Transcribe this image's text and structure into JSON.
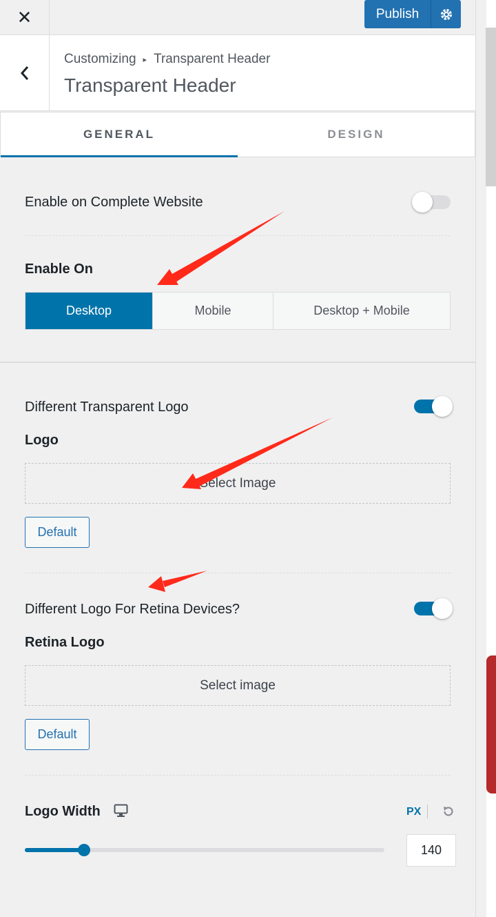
{
  "topbar": {
    "close_label": "✕",
    "publish_label": "Publish"
  },
  "header": {
    "breadcrumb_root": "Customizing",
    "breadcrumb_sep": "▸",
    "breadcrumb_current": "Transparent Header",
    "title": "Transparent Header"
  },
  "tabs": [
    {
      "label": "GENERAL",
      "active": true
    },
    {
      "label": "DESIGN",
      "active": false
    }
  ],
  "settings": {
    "enable_complete": {
      "label": "Enable on Complete Website",
      "on": false
    },
    "enable_on": {
      "label": "Enable On",
      "options": [
        "Desktop",
        "Mobile",
        "Desktop + Mobile"
      ],
      "selected": "Desktop"
    },
    "transparent_logo": {
      "label": "Different Transparent Logo",
      "on": true
    },
    "logo": {
      "label": "Logo",
      "select_label": "Select Image",
      "default_label": "Default"
    },
    "retina_toggle": {
      "label": "Different Logo For Retina Devices?",
      "on": true
    },
    "retina_logo": {
      "label": "Retina Logo",
      "select_label": "Select image",
      "default_label": "Default"
    },
    "logo_width": {
      "label": "Logo Width",
      "unit": "PX",
      "value": "140",
      "slider_fraction": 0.165
    }
  },
  "colors": {
    "accent": "#0073aa",
    "publish": "#2271b1",
    "annotation_arrow": "#ff2a1a"
  },
  "icons": [
    "close-icon",
    "gear-icon",
    "back-arrow-icon",
    "monitor-icon",
    "reset-icon"
  ]
}
